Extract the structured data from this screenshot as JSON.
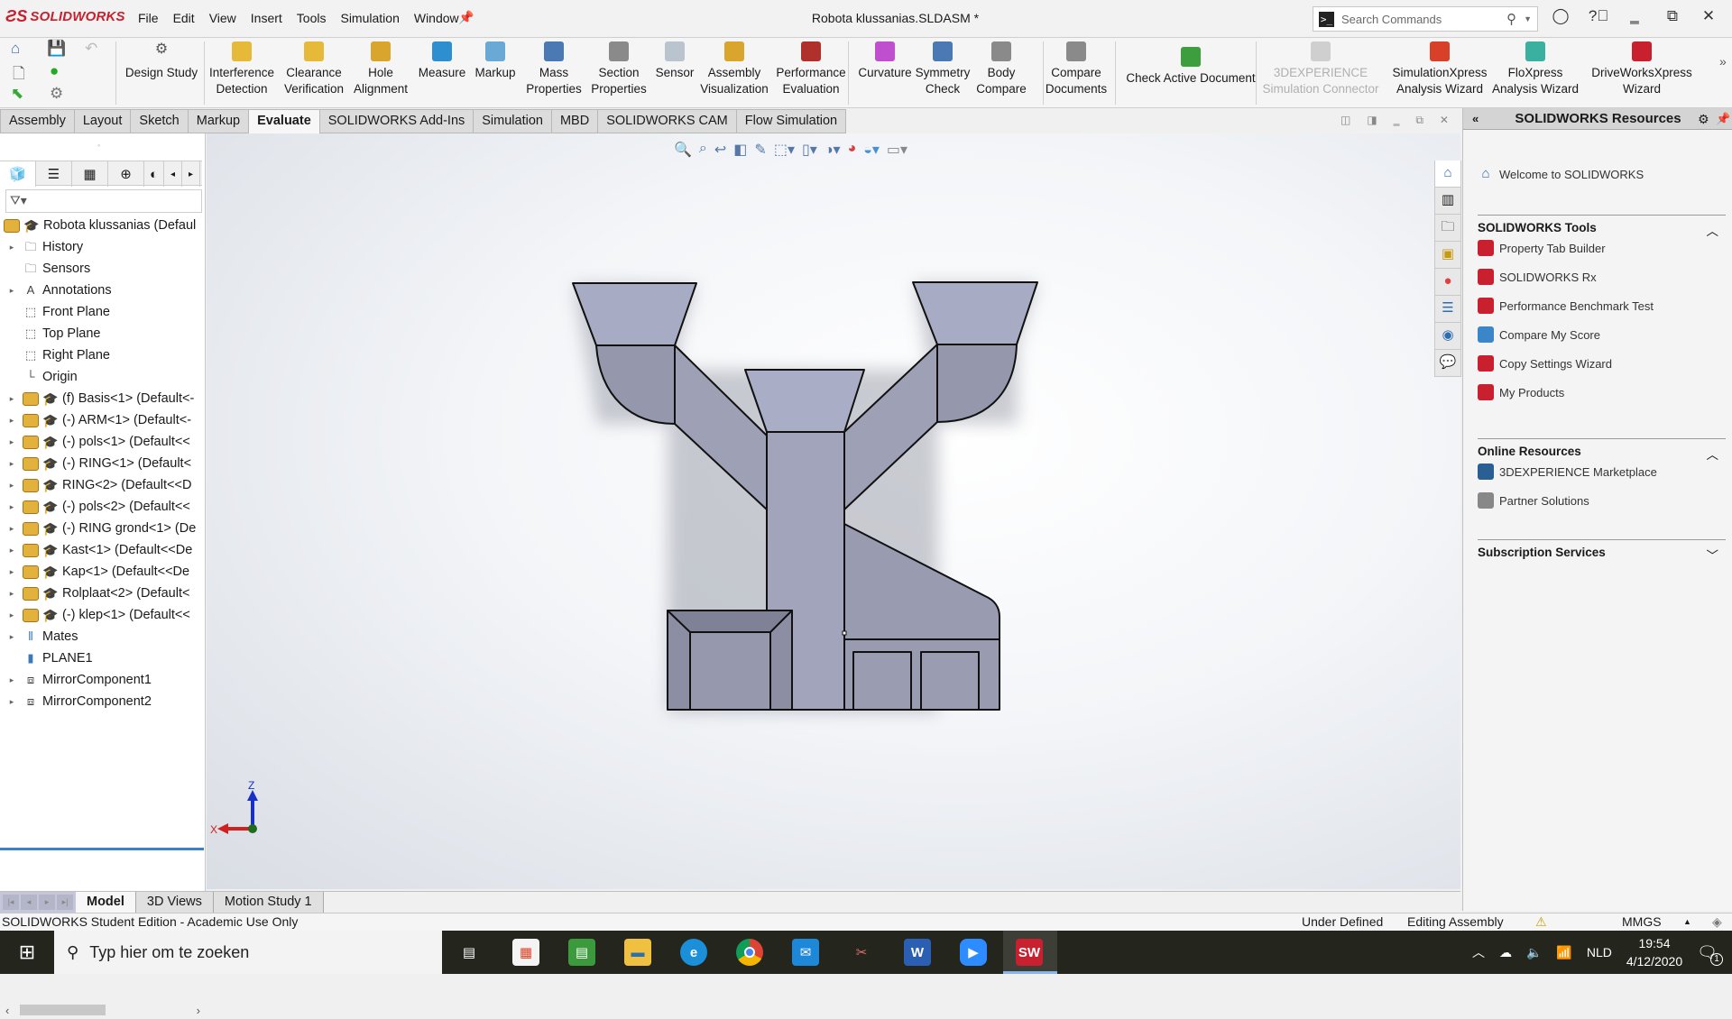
{
  "app": {
    "logo": "SOLIDWORKS",
    "document_title": "Robota klussanias.SLDASM *",
    "menu": [
      "File",
      "Edit",
      "View",
      "Insert",
      "Tools",
      "Simulation",
      "Window"
    ],
    "search_placeholder": "Search Commands"
  },
  "commandmanager": {
    "design_study": "Design Study",
    "tools": [
      {
        "label": "Interference\nDetection",
        "icon": "interference-detection-icon",
        "color": "#e6b93a"
      },
      {
        "label": "Clearance\nVerification",
        "icon": "clearance-verification-icon",
        "color": "#e6b93a"
      },
      {
        "label": "Hole\nAlignment",
        "icon": "hole-alignment-icon",
        "color": "#d9a52c"
      },
      {
        "label": "Measure",
        "icon": "measure-icon",
        "color": "#2d8fd0"
      },
      {
        "label": "Markup",
        "icon": "markup-icon",
        "color": "#6aa8d6"
      },
      {
        "label": "Mass\nProperties",
        "icon": "mass-properties-icon",
        "color": "#4a79b3"
      },
      {
        "label": "Section\nProperties",
        "icon": "section-properties-icon",
        "color": "#8a8a8a"
      },
      {
        "label": "Sensor",
        "icon": "sensor-icon",
        "color": "#b9c4cf"
      },
      {
        "label": "Assembly\nVisualization",
        "icon": "assembly-visualization-icon",
        "color": "#d9a52c"
      },
      {
        "label": "Performance\nEvaluation",
        "icon": "performance-evaluation-icon",
        "color": "#b0302c"
      },
      {
        "label": "Curvature",
        "icon": "curvature-icon",
        "color": "#c04fd0"
      },
      {
        "label": "Symmetry\nCheck",
        "icon": "symmetry-check-icon",
        "color": "#4a79b3"
      },
      {
        "label": "Body\nCompare",
        "icon": "body-compare-icon",
        "color": "#8a8a8a"
      },
      {
        "label": "Compare\nDocuments",
        "icon": "compare-documents-icon",
        "color": "#8a8a8a"
      },
      {
        "label": "Check Active Document",
        "icon": "check-active-document-icon",
        "color": "#3c9e3c"
      },
      {
        "label": "3DEXPERIENCE\nSimulation Connector",
        "icon": "3dexperience-connector-icon",
        "color": "#cfcfcf",
        "disabled": true
      },
      {
        "label": "SimulationXpress\nAnalysis Wizard",
        "icon": "simulationxpress-icon",
        "color": "#d8402a"
      },
      {
        "label": "FloXpress\nAnalysis Wizard",
        "icon": "floxpress-icon",
        "color": "#3ab0a0"
      },
      {
        "label": "DriveWorksXpress\nWizard",
        "icon": "driveworksxpress-icon",
        "color": "#c8202f"
      }
    ]
  },
  "tabs": [
    "Assembly",
    "Layout",
    "Sketch",
    "Markup",
    "Evaluate",
    "SOLIDWORKS Add-Ins",
    "Simulation",
    "MBD",
    "SOLIDWORKS CAM",
    "Flow Simulation"
  ],
  "active_tab": "Evaluate",
  "feature_tree": {
    "root": "Robota klussanias  (Defaul",
    "items": [
      {
        "label": "History",
        "type": "folder",
        "expandable": true
      },
      {
        "label": "Sensors",
        "type": "folder",
        "expandable": false
      },
      {
        "label": "Annotations",
        "type": "annotations",
        "expandable": true
      },
      {
        "label": "Front Plane",
        "type": "plane",
        "expandable": false
      },
      {
        "label": "Top Plane",
        "type": "plane",
        "expandable": false
      },
      {
        "label": "Right Plane",
        "type": "plane",
        "expandable": false
      },
      {
        "label": "Origin",
        "type": "origin",
        "expandable": false
      },
      {
        "label": "(f) Basis<1> (Default<-",
        "type": "component",
        "expandable": true
      },
      {
        "label": "(-) ARM<1> (Default<-",
        "type": "component",
        "expandable": true
      },
      {
        "label": "(-) pols<1> (Default<<",
        "type": "component",
        "expandable": true
      },
      {
        "label": "(-) RING<1> (Default<",
        "type": "component",
        "expandable": true
      },
      {
        "label": "RING<2> (Default<<D",
        "type": "component",
        "expandable": true
      },
      {
        "label": "(-) pols<2> (Default<<",
        "type": "component",
        "expandable": true
      },
      {
        "label": "(-) RING grond<1> (De",
        "type": "component",
        "expandable": true
      },
      {
        "label": "Kast<1> (Default<<De",
        "type": "component",
        "expandable": true
      },
      {
        "label": "Kap<1> (Default<<De",
        "type": "component",
        "expandable": true
      },
      {
        "label": "Rolplaat<2> (Default<",
        "type": "component",
        "expandable": true
      },
      {
        "label": "(-) klep<1> (Default<<",
        "type": "component",
        "expandable": true
      },
      {
        "label": "Mates",
        "type": "mates",
        "expandable": true
      },
      {
        "label": "PLANE1",
        "type": "plane-solid",
        "expandable": false
      },
      {
        "label": "MirrorComponent1",
        "type": "mirror",
        "expandable": true
      },
      {
        "label": "MirrorComponent2",
        "type": "mirror",
        "expandable": true
      }
    ]
  },
  "triad": {
    "x": "X",
    "z": "Z"
  },
  "bottom_tabs": [
    "Model",
    "3D Views",
    "Motion Study 1"
  ],
  "active_bottom_tab": "Model",
  "status": {
    "left": "SOLIDWORKS Student Edition - Academic Use Only",
    "state": "Under Defined",
    "mode": "Editing Assembly",
    "units": "MMGS"
  },
  "taskpane": {
    "title": "SOLIDWORKS Resources",
    "welcome": "Welcome to SOLIDWORKS",
    "sections": [
      {
        "title": "SOLIDWORKS Tools",
        "expanded": true,
        "items": [
          "Property Tab Builder",
          "SOLIDWORKS Rx",
          "Performance Benchmark Test",
          "Compare My Score",
          "Copy Settings Wizard",
          "My Products"
        ]
      },
      {
        "title": "Online Resources",
        "expanded": true,
        "items": [
          "3DEXPERIENCE Marketplace",
          "Partner Solutions"
        ]
      },
      {
        "title": "Subscription Services",
        "expanded": false,
        "items": []
      }
    ]
  },
  "taskbar": {
    "search_placeholder": "Typ hier om te zoeken",
    "apps": [
      "task-view",
      "microsoft-store",
      "notes",
      "file-explorer",
      "edge",
      "chrome",
      "mail",
      "snip",
      "word",
      "zoom",
      "solidworks"
    ],
    "language": "NLD",
    "time": "19:54",
    "date": "4/12/2020",
    "notifications": "1"
  }
}
